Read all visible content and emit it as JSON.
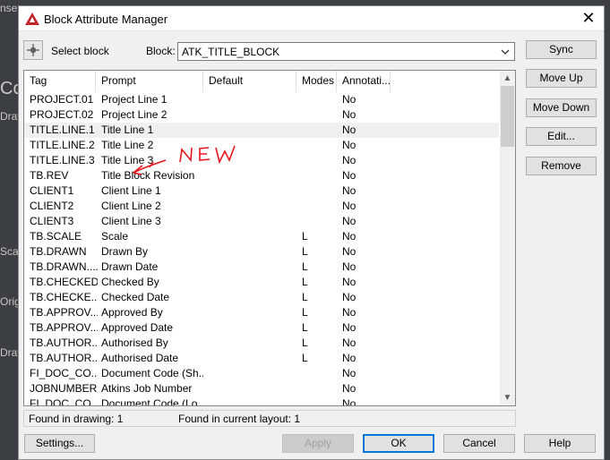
{
  "background": {
    "fragments": [
      "nsel",
      "Co",
      "Draw",
      "Sca",
      "Orig",
      "Draw"
    ]
  },
  "dialog": {
    "title": "Block Attribute Manager",
    "close_glyph": "✕"
  },
  "block_selector": {
    "select_label": "Select block",
    "block_label": "Block:",
    "block_value": "ATK_TITLE_BLOCK"
  },
  "table": {
    "columns": [
      "Tag",
      "Prompt",
      "Default",
      "Modes",
      "Annotati..."
    ],
    "rows": [
      {
        "tag": "PROJECT.01",
        "prompt": "Project Line 1",
        "default": "",
        "modes": "",
        "annot": "No"
      },
      {
        "tag": "PROJECT.02",
        "prompt": "Project Line 2",
        "default": "",
        "modes": "",
        "annot": "No"
      },
      {
        "tag": "TITLE.LINE.1",
        "prompt": "Title Line 1",
        "default": "",
        "modes": "",
        "annot": "No"
      },
      {
        "tag": "TITLE.LINE.2",
        "prompt": "Title Line 2",
        "default": "",
        "modes": "",
        "annot": "No"
      },
      {
        "tag": "TITLE.LINE.3",
        "prompt": "Title Line 3",
        "default": "",
        "modes": "",
        "annot": "No"
      },
      {
        "tag": "TB.REV",
        "prompt": "Title Block Revision",
        "default": "",
        "modes": "",
        "annot": "No"
      },
      {
        "tag": "CLIENT1",
        "prompt": "Client Line 1",
        "default": "",
        "modes": "",
        "annot": "No"
      },
      {
        "tag": "CLIENT2",
        "prompt": "Client Line 2",
        "default": "",
        "modes": "",
        "annot": "No"
      },
      {
        "tag": "CLIENT3",
        "prompt": "Client Line 3",
        "default": "",
        "modes": "",
        "annot": "No"
      },
      {
        "tag": "TB.SCALE",
        "prompt": "Scale",
        "default": "",
        "modes": "L",
        "annot": "No"
      },
      {
        "tag": "TB.DRAWN",
        "prompt": "Drawn By",
        "default": "",
        "modes": "L",
        "annot": "No"
      },
      {
        "tag": "TB.DRAWN....",
        "prompt": "Drawn Date",
        "default": "",
        "modes": "L",
        "annot": "No"
      },
      {
        "tag": "TB.CHECKED",
        "prompt": "Checked By",
        "default": "",
        "modes": "L",
        "annot": "No"
      },
      {
        "tag": "TB.CHECKE...",
        "prompt": "Checked Date",
        "default": "",
        "modes": "L",
        "annot": "No"
      },
      {
        "tag": "TB.APPROV...",
        "prompt": "Approved By",
        "default": "",
        "modes": "L",
        "annot": "No"
      },
      {
        "tag": "TB.APPROV...",
        "prompt": "Approved Date",
        "default": "",
        "modes": "L",
        "annot": "No"
      },
      {
        "tag": "TB.AUTHOR...",
        "prompt": "Authorised By",
        "default": "",
        "modes": "L",
        "annot": "No"
      },
      {
        "tag": "TB.AUTHOR...",
        "prompt": "Authorised Date",
        "default": "",
        "modes": "L",
        "annot": "No"
      },
      {
        "tag": "FI_DOC_CO...",
        "prompt": "Document Code (Sh...",
        "default": "",
        "modes": "",
        "annot": "No"
      },
      {
        "tag": "JOBNUMBER",
        "prompt": "Atkins Job Number",
        "default": "",
        "modes": "",
        "annot": "No"
      },
      {
        "tag": "FI_DOC_CO...",
        "prompt": "Document Code (Lo...",
        "default": "",
        "modes": "",
        "annot": "No"
      }
    ],
    "selected_row": 2
  },
  "status": {
    "found_in_drawing": "Found in drawing: 1",
    "found_in_layout": "Found in current layout: 1"
  },
  "side_buttons": {
    "sync": "Sync",
    "move_up": "Move Up",
    "move_down": "Move Down",
    "edit": "Edit...",
    "remove": "Remove"
  },
  "bottom_buttons": {
    "settings": "Settings...",
    "apply": "Apply",
    "ok": "OK",
    "cancel": "Cancel",
    "help": "Help"
  },
  "annotation": {
    "text": "NEW",
    "color": "#e8141c"
  },
  "colors": {
    "autocad_red": "#c0272d",
    "focus_blue": "#0078d7"
  }
}
